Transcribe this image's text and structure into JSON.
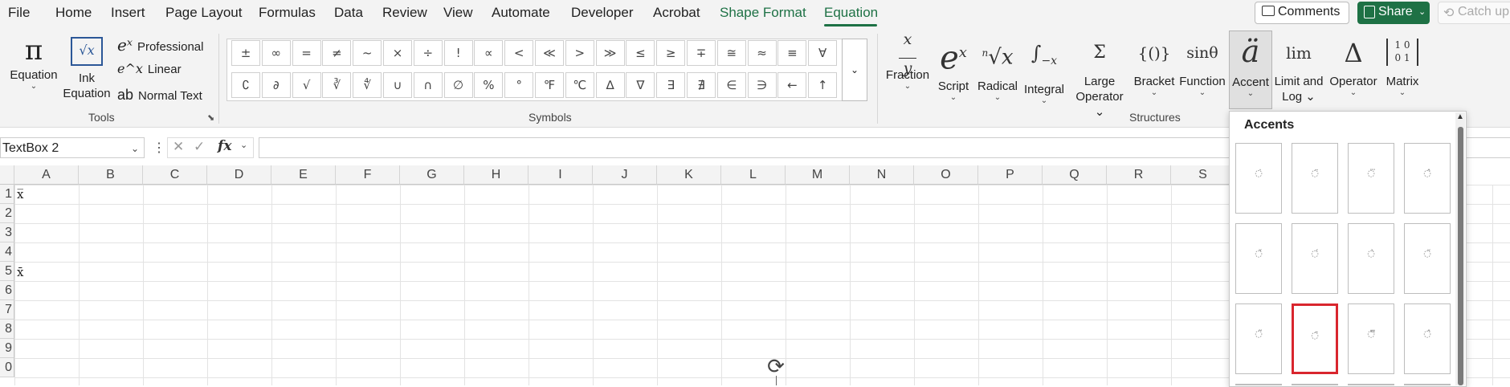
{
  "menu": {
    "tabs": [
      "File",
      "Home",
      "Insert",
      "Page Layout",
      "Formulas",
      "Data",
      "Review",
      "View",
      "Automate",
      "Developer",
      "Acrobat",
      "Shape Format",
      "Equation"
    ],
    "active_tab": "Equation",
    "comments_label": "Comments",
    "share_label": "Share",
    "catchup_label": "Catch up"
  },
  "ribbon": {
    "tools": {
      "equation_label": "Equation",
      "ink_equation_label": "Ink Equation",
      "professional_label": "Professional",
      "linear_label": "Linear",
      "normal_text_label": "Normal Text",
      "group_label": "Tools"
    },
    "symbols": {
      "row1": [
        "±",
        "∞",
        "=",
        "≠",
        "~",
        "×",
        "÷",
        "!",
        "∝",
        "<",
        "≪",
        ">",
        "≫",
        "≤",
        "≥",
        "∓",
        "≅",
        "≈",
        "≡",
        "∀"
      ],
      "row2": [
        "∁",
        "∂",
        "√",
        "∛",
        "∜",
        "∪",
        "∩",
        "∅",
        "%",
        "°",
        "℉",
        "℃",
        "∆",
        "∇",
        "∃",
        "∄",
        "∈",
        "∋",
        "←",
        "↑"
      ],
      "group_label": "Symbols"
    },
    "structures": {
      "items": [
        {
          "label": "Fraction",
          "icon": "x/y"
        },
        {
          "label": "Script",
          "icon": "eˣ"
        },
        {
          "label": "Radical",
          "icon": "ⁿ√x"
        },
        {
          "label": "Integral",
          "icon": "∫x"
        },
        {
          "label": "Large Operator",
          "icon": "Σ"
        },
        {
          "label": "Bracket",
          "icon": "{()}"
        },
        {
          "label": "Function",
          "icon": "sinθ"
        },
        {
          "label": "Accent",
          "icon": "ä"
        },
        {
          "label": "Limit and Log",
          "icon": "lim"
        },
        {
          "label": "Operator",
          "icon": "Δ"
        },
        {
          "label": "Matrix",
          "icon": "[10/01]"
        }
      ],
      "group_label": "Structures"
    }
  },
  "formula_bar": {
    "name_box": "TextBox 2",
    "fx_label": "fx",
    "value": ""
  },
  "grid": {
    "columns": [
      "A",
      "B",
      "C",
      "D",
      "E",
      "F",
      "G",
      "H",
      "I",
      "J",
      "K",
      "L",
      "M",
      "N",
      "O",
      "P",
      "Q",
      "R",
      "S"
    ],
    "rows": [
      "1",
      "2",
      "3",
      "4",
      "5",
      "6",
      "7",
      "8",
      "9",
      "0"
    ],
    "cell_a1": "x̅",
    "cell_a5": "x̄"
  },
  "accents_dropdown": {
    "title": "Accents",
    "tiles": [
      {
        "glyph": "◌̇"
      },
      {
        "glyph": "◌̈"
      },
      {
        "glyph": "◌⃛"
      },
      {
        "glyph": "◌̂"
      },
      {
        "glyph": "◌̌"
      },
      {
        "glyph": "◌́"
      },
      {
        "glyph": "◌̀"
      },
      {
        "glyph": "◌̆"
      },
      {
        "glyph": "◌̃"
      },
      {
        "glyph": "◌̄"
      },
      {
        "glyph": "◌̿"
      },
      {
        "glyph": "◌̂"
      }
    ],
    "selected_index": 9
  }
}
